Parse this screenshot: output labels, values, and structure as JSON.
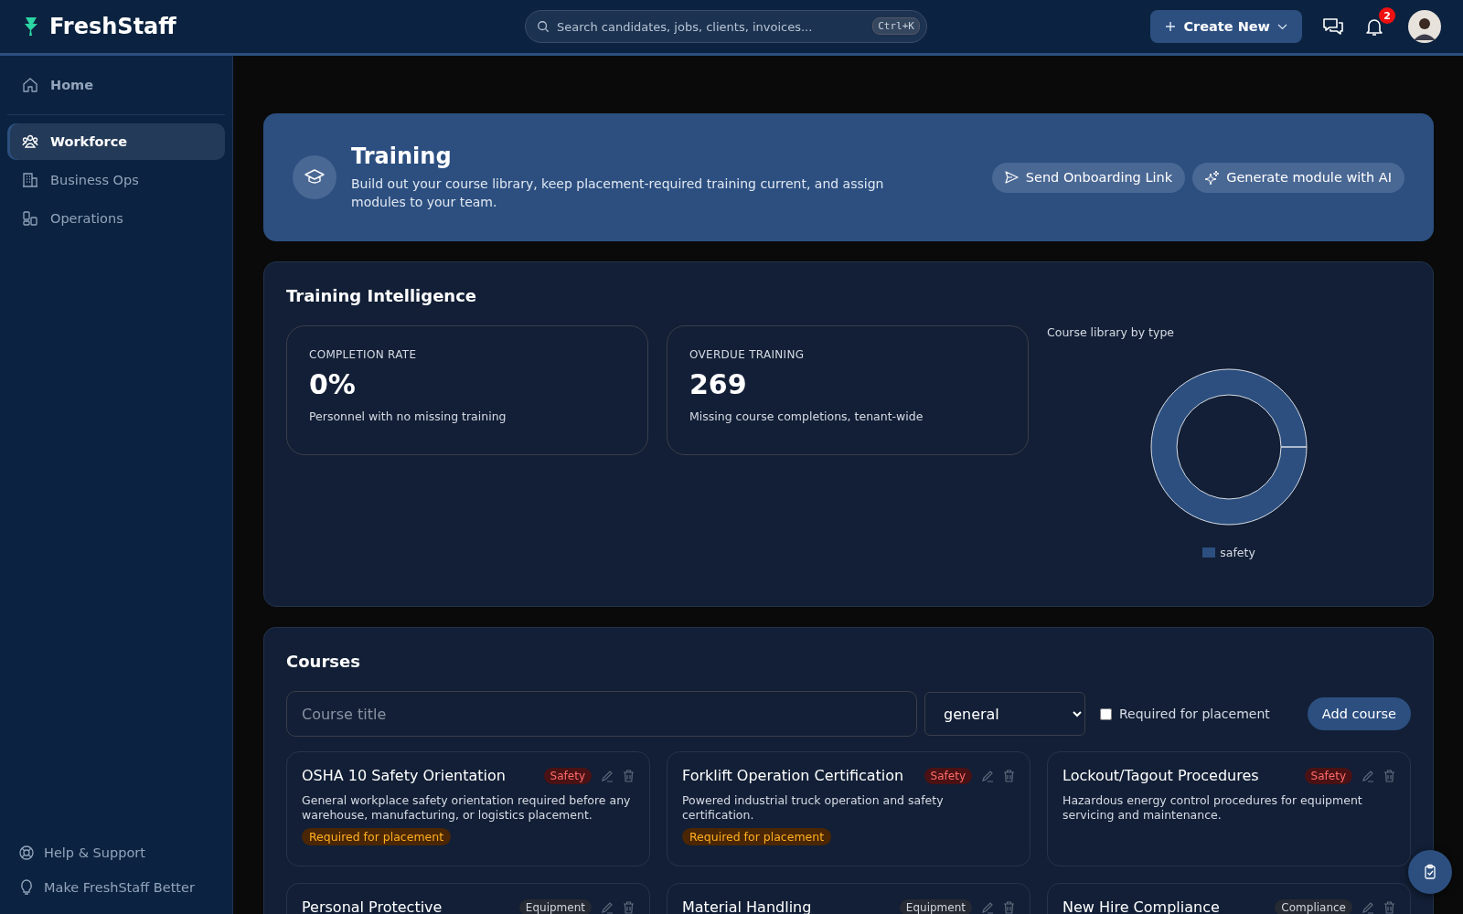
{
  "brand": "FreshStaff",
  "search": {
    "placeholder": "Search candidates, jobs, clients, invoices...",
    "shortcut": "Ctrl+K"
  },
  "create_button": "Create New",
  "notifications": {
    "count": "2"
  },
  "sidebar": {
    "items": [
      {
        "label": "Home",
        "selected": false
      },
      {
        "label": "Workforce",
        "selected": true
      },
      {
        "label": "Business Ops",
        "selected": false
      },
      {
        "label": "Operations",
        "selected": false
      }
    ],
    "footer": [
      {
        "label": "Help & Support"
      },
      {
        "label": "Make FreshStaff Better"
      }
    ]
  },
  "banner": {
    "title": "Training",
    "description": "Build out your course library, keep placement-required training current, and assign modules to your team.",
    "buttons": [
      {
        "label": "Send Onboarding Link"
      },
      {
        "label": "Generate module with AI"
      }
    ]
  },
  "intelligence": {
    "title": "Training Intelligence",
    "stats": [
      {
        "label": "COMPLETION RATE",
        "value": "0%",
        "note": "Personnel with no missing training"
      },
      {
        "label": "OVERDUE TRAINING",
        "value": "269",
        "note": "Missing course completions, tenant-wide"
      }
    ],
    "chart": {
      "title": "Course library by type",
      "legend": [
        {
          "label": "safety",
          "color": "#2c4f80"
        }
      ]
    }
  },
  "courses": {
    "title": "Courses",
    "title_field": {
      "placeholder": "Course title"
    },
    "type_select": {
      "value": "general"
    },
    "required_checkbox": {
      "label": "Required for placement",
      "checked": false
    },
    "add_button": "Add course",
    "items": [
      {
        "title": "OSHA 10 Safety Orientation",
        "tag": {
          "label": "Safety",
          "color": "#4a1214"
        },
        "description": "General workplace safety orientation required before any warehouse, manufacturing, or logistics placement.",
        "badge": "Required for placement"
      },
      {
        "title": "Forklift Operation Certification",
        "tag": {
          "label": "Safety",
          "color": "#4a1214"
        },
        "description": "Powered industrial truck operation and safety certification.",
        "badge": "Required for placement"
      },
      {
        "title": "Lockout/Tagout Procedures",
        "tag": {
          "label": "Safety",
          "color": "#4a1214"
        },
        "description": "Hazardous energy control procedures for equipment servicing and maintenance."
      },
      {
        "title": "Personal Protective",
        "tag": {
          "label": "Equipment",
          "color": "#262a33"
        }
      },
      {
        "title": "Material Handling",
        "tag": {
          "label": "Equipment",
          "color": "#262a33"
        }
      },
      {
        "title": "New Hire Compliance",
        "tag": {
          "label": "Compliance",
          "color": "#262a33"
        }
      }
    ]
  }
}
